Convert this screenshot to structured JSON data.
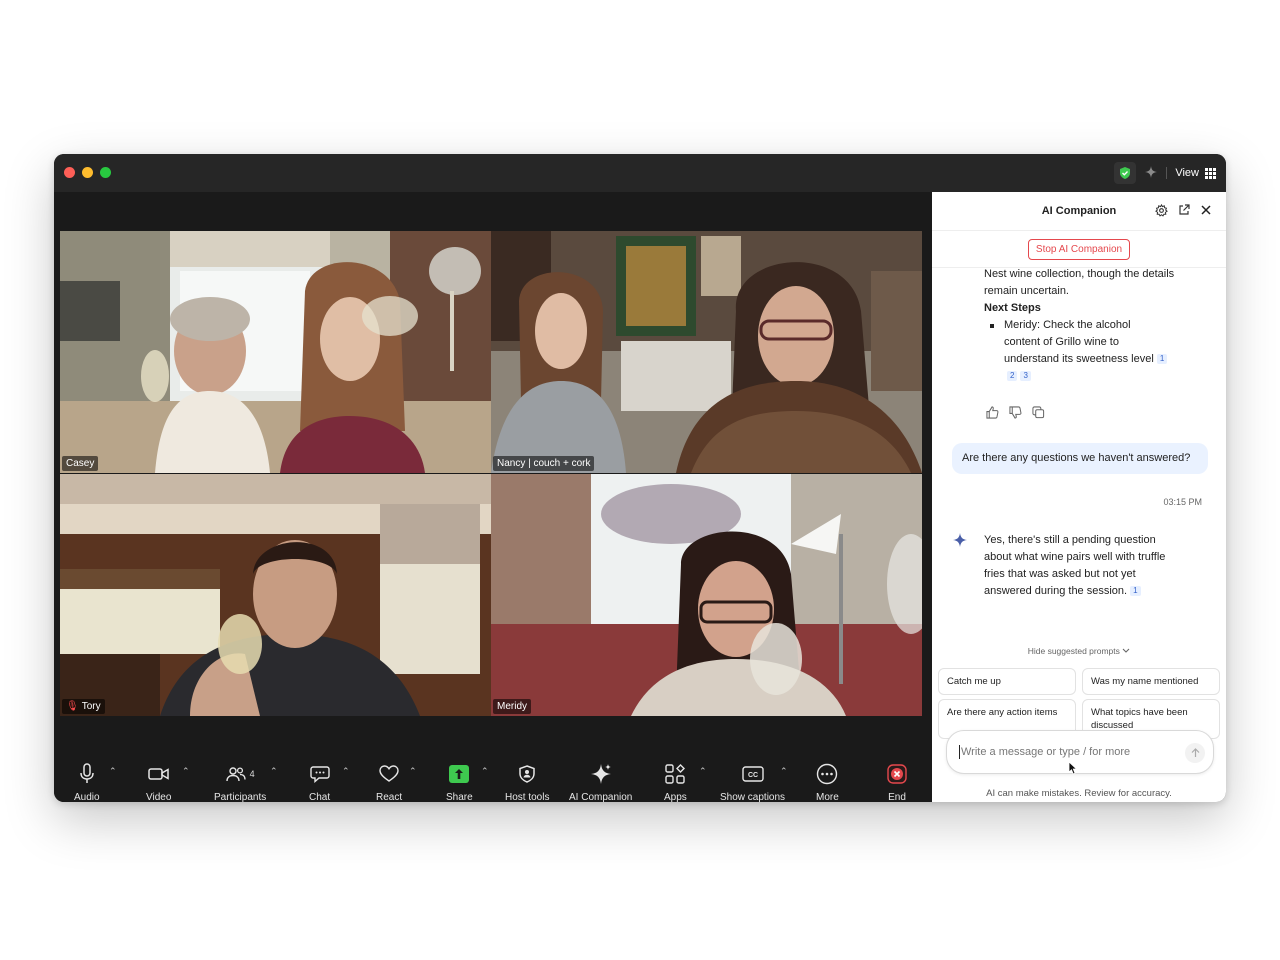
{
  "titlebar": {
    "view_label": "View"
  },
  "tiles": [
    {
      "name": "Casey",
      "muted": false,
      "active": false
    },
    {
      "name": "Nancy | couch + cork",
      "muted": false,
      "active": true
    },
    {
      "name": "Tory",
      "muted": true,
      "active": false
    },
    {
      "name": "Meridy",
      "muted": false,
      "active": false
    }
  ],
  "toolbar": {
    "audio": "Audio",
    "video": "Video",
    "participants": "Participants",
    "participants_count": "4",
    "chat": "Chat",
    "react": "React",
    "share": "Share",
    "host_tools": "Host tools",
    "ai_companion": "AI Companion",
    "apps": "Apps",
    "show_captions": "Show captions",
    "more": "More",
    "end": "End"
  },
  "panel": {
    "title": "AI Companion",
    "stop_label": "Stop AI Companion",
    "summary_tail_1": "Nest wine collection, though the details",
    "summary_tail_2": "remain uncertain.",
    "next_steps_heading": "Next Steps",
    "next_step_1": "Meridy: Check the alcohol",
    "next_step_2": "content of Grillo wine to",
    "next_step_3": "understand its sweetness level",
    "cite_1": "1",
    "cite_2": "2",
    "cite_3": "3",
    "user_message": "Are there any questions we haven't answered?",
    "timestamp": "03:15 PM",
    "ai_reply_1": "Yes, there's still a pending question",
    "ai_reply_2": "about what wine pairs well with truffle",
    "ai_reply_3": "fries that was asked but not yet",
    "ai_reply_4": "answered during the session.",
    "hide_prompts": "Hide suggested prompts",
    "prompts": [
      "Catch me up",
      "Was my name mentioned",
      "Are there any action items",
      "What topics have been discussed"
    ],
    "input_placeholder": "Write a message or type / for more",
    "disclaimer": "AI can make mistakes. Review for accuracy."
  },
  "colors": {
    "accent_green": "#3ec94f",
    "stop_red": "#e5484d",
    "bubble_blue": "#eaf2ff"
  }
}
